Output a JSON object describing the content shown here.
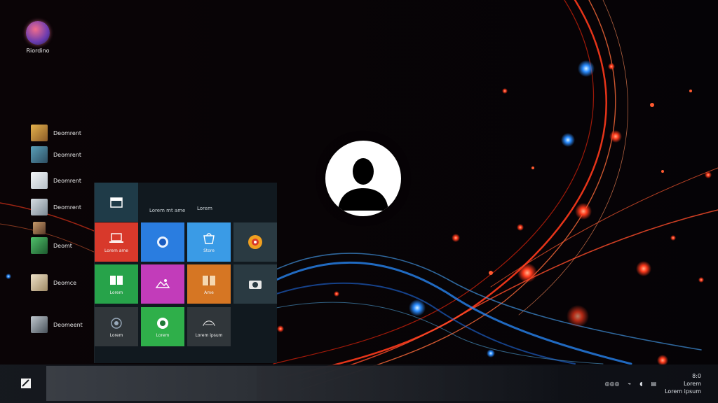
{
  "colors": {
    "tile_red": "#d8392b",
    "tile_blue": "#2a7de0",
    "tile_lightblue": "#3a9be6",
    "tile_dark": "#2a3a42",
    "tile_green": "#27a34a",
    "tile_magenta": "#c23cba",
    "tile_orange": "#d67623",
    "tile_brightgreen": "#2faf4a",
    "tile_charcoal": "#30363a"
  },
  "desktop": {
    "icons": [
      {
        "name": "Recycle-bin style icon",
        "label": "Riordino"
      }
    ]
  },
  "start_menu": {
    "app_list": [
      {
        "label": "Deomrent",
        "icon": "photo-app-icon",
        "color": "#c8923a"
      },
      {
        "label": "Deomrent",
        "icon": "image-app-icon",
        "color": "#3e6b83"
      },
      {
        "label": "Deomrent",
        "icon": "document-app-icon",
        "color": "#d8dde3"
      },
      {
        "label": "Deomrent",
        "icon": "document-app-icon",
        "color": "#b9c3cb"
      },
      {
        "label": "",
        "icon": "media-app-icon",
        "color": "#7a5a44"
      },
      {
        "label": "Deomt",
        "icon": "chart-app-icon",
        "color": "#3c8c4c"
      },
      {
        "label": "Deomce",
        "icon": "note-app-icon",
        "color": "#cbb89a"
      },
      {
        "label": "Deomeent",
        "icon": "settings-app-icon",
        "color": "#9aa4ad"
      }
    ],
    "tiles_header": {
      "label_1": "Lorem mt ame",
      "label_2": "Lorem"
    },
    "tiles": [
      {
        "label": "",
        "icon": "calendar-icon",
        "color": "#1f3b48"
      },
      {
        "label": "Lorem ame",
        "icon": "laptop-icon",
        "color": "#d8392b"
      },
      {
        "label": "",
        "icon": "browser-icon",
        "color": "#2a7de0"
      },
      {
        "label": "Store",
        "icon": "store-icon",
        "color": "#3a9be6"
      },
      {
        "label": "",
        "icon": "media-icon",
        "color": "#2a3a42"
      },
      {
        "label": "Lorem",
        "icon": "book-icon",
        "color": "#27a34a"
      },
      {
        "label": "",
        "icon": "photos-icon",
        "color": "#c23cba"
      },
      {
        "label": "Ame",
        "icon": "folder-icon",
        "color": "#d67623"
      },
      {
        "label": "",
        "icon": "camera-icon",
        "color": "#2a3a42"
      },
      {
        "label": "Lorem",
        "icon": "mail-icon",
        "color": "#30363a"
      },
      {
        "label": "Lorem",
        "icon": "messaging-icon",
        "color": "#2faf4a"
      },
      {
        "label": "Lorem ipsum",
        "icon": "xbox-icon",
        "color": "#30363a"
      }
    ]
  },
  "taskbar": {
    "tray": {
      "time": "8:0",
      "date_1": "Lorem",
      "date_2": "Lorem ipsum"
    }
  }
}
